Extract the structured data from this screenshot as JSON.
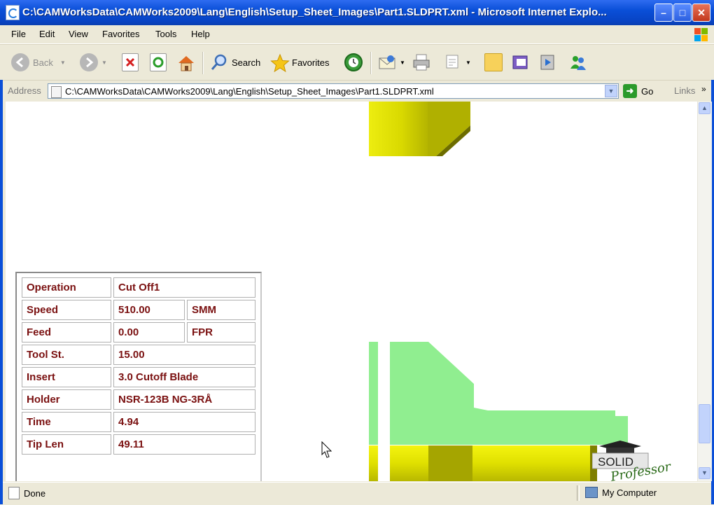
{
  "window": {
    "title": "C:\\CAMWorksData\\CAMWorks2009\\Lang\\English\\Setup_Sheet_Images\\Part1.SLDPRT.xml - Microsoft Internet Explo...",
    "minimize": "–",
    "maximize": "□",
    "close": "✕"
  },
  "menu": [
    "File",
    "Edit",
    "View",
    "Favorites",
    "Tools",
    "Help"
  ],
  "toolbar": {
    "back_label": "Back",
    "search_label": "Search",
    "favorites_label": "Favorites"
  },
  "address": {
    "label": "Address",
    "value": "C:\\CAMWorksData\\CAMWorks2009\\Lang\\English\\Setup_Sheet_Images\\Part1.SLDPRT.xml",
    "go_label": "Go",
    "links_label": "Links"
  },
  "operation_table": {
    "rows": [
      {
        "key": "Operation",
        "value": "Cut Off1",
        "unit": ""
      },
      {
        "key": "Speed",
        "value": "510.00",
        "unit": "SMM"
      },
      {
        "key": "Feed",
        "value": "0.00",
        "unit": "FPR"
      },
      {
        "key": "Tool St.",
        "value": "15.00",
        "unit": ""
      },
      {
        "key": "Insert",
        "value": "3.0 Cutoff Blade",
        "unit": ""
      },
      {
        "key": "Holder",
        "value": "NSR-123B NG-3RÅ",
        "unit": ""
      },
      {
        "key": "Time",
        "value": "4.94",
        "unit": ""
      },
      {
        "key": "Tip Len",
        "value": "49.11",
        "unit": ""
      }
    ]
  },
  "logo": {
    "line1": "SOLID",
    "line2": "Professor"
  },
  "status": {
    "left": "Done",
    "zone": "My Computer"
  },
  "colors": {
    "part_yellow": "#e3e300",
    "toolpath_green": "#90ee90",
    "label_red": "#7a1010",
    "xp_blue": "#0a4fd8"
  }
}
